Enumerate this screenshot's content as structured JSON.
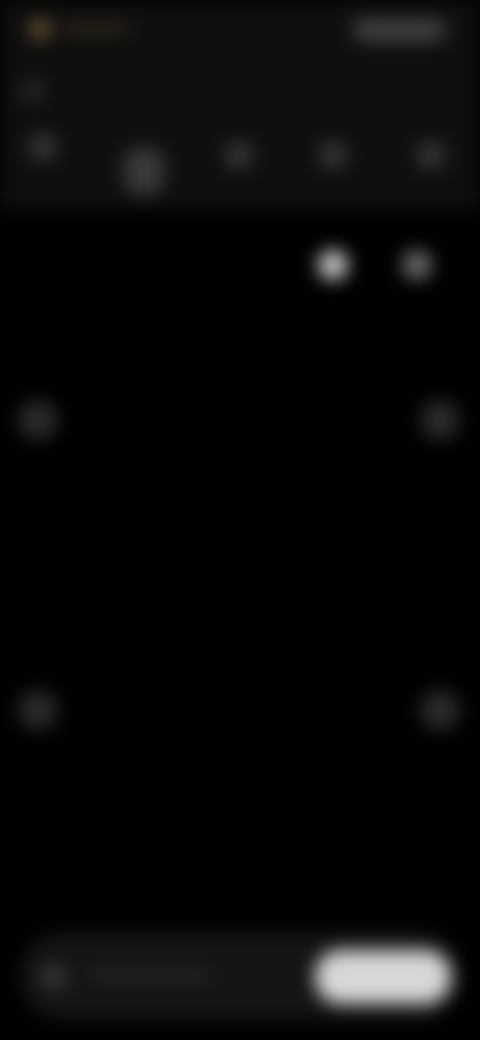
{
  "app": {
    "brand_label": "",
    "top_action_label": ""
  },
  "mode_bar": {
    "items": [
      {
        "label": "",
        "active": false
      },
      {
        "label": "",
        "active": true
      },
      {
        "label": "",
        "active": false
      },
      {
        "label": "",
        "active": false
      },
      {
        "label": "",
        "active": false
      }
    ]
  },
  "view_controls": {
    "items": [
      {
        "label": ""
      },
      {
        "label": ""
      }
    ]
  },
  "bottom_bar": {
    "left_label": "",
    "primary_label": ""
  },
  "colors": {
    "background": "#000000",
    "header_background": "#0e0e0e",
    "brand_accent": "#7a5b36",
    "primary_button": "#d7d7d7"
  },
  "icons": {
    "brand": "app-logo-icon",
    "small": "menu-icon",
    "mode_items": [
      "mode-icon",
      "mode-icon",
      "mode-icon",
      "mode-icon",
      "mode-icon"
    ],
    "view_controls": [
      "view-icon",
      "view-icon"
    ],
    "edges": [
      "left-arrow-icon",
      "right-arrow-icon",
      "left-arrow-icon",
      "right-arrow-icon"
    ],
    "bottom_left": "gallery-icon"
  }
}
